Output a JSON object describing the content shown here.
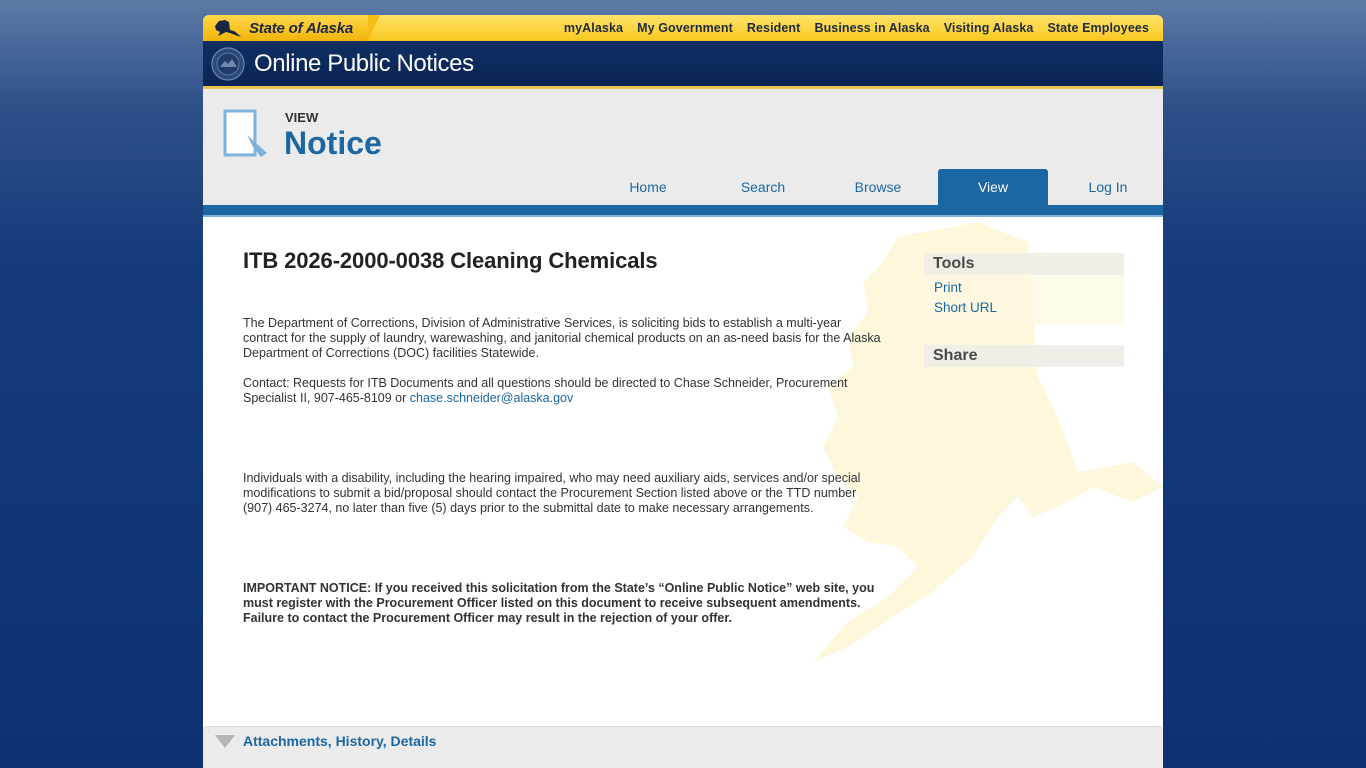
{
  "brand": {
    "state_label": "State of Alaska",
    "site_title": "Online Public Notices"
  },
  "top_links": [
    "myAlaska",
    "My Government",
    "Resident",
    "Business in Alaska",
    "Visiting Alaska",
    "State Employees"
  ],
  "header": {
    "view_label": "VIEW",
    "page_label": "Notice"
  },
  "nav": {
    "items": [
      "Home",
      "Search",
      "Browse",
      "View",
      "Log In"
    ],
    "active": "View"
  },
  "notice": {
    "title": "ITB 2026-2000-0038 Cleaning Chemicals",
    "para1": "The Department of Corrections, Division of Administrative Services, is soliciting bids to establish a multi-year contract for the supply of laundry, warewashing, and janitorial chemical products on an as-need basis for the Alaska Department of Corrections (DOC) facilities Statewide.",
    "contact_text": "Contact:  Requests for ITB Documents and all questions should be directed to Chase Schneider, Procurement Specialist II, 907-465-8109 or ",
    "contact_email": "chase.schneider@alaska.gov",
    "para3": "Individuals with a disability, including the hearing impaired, who may need auxiliary aids, services and/or special modifications to submit a bid/proposal should contact the Procurement Section listed above or the TTD number (907) 465-3274, no later than five (5) days prior to the submittal date to make necessary arrangements.",
    "important": "IMPORTANT NOTICE: If you received this solicitation from the State’s “Online Public Notice” web site, you must register with the Procurement Officer listed on this document to receive subsequent amendments. Failure to contact the Procurement Officer may result in the rejection of your offer."
  },
  "sidebar": {
    "tools_title": "Tools",
    "tools_links": [
      "Print",
      "Short URL"
    ],
    "share_title": "Share"
  },
  "accordion": {
    "label": "Attachments, History, Details"
  },
  "colors": {
    "accent_blue": "#1b67a4",
    "banner_navy": "#0f2f63",
    "gold": "#f8c81e"
  }
}
